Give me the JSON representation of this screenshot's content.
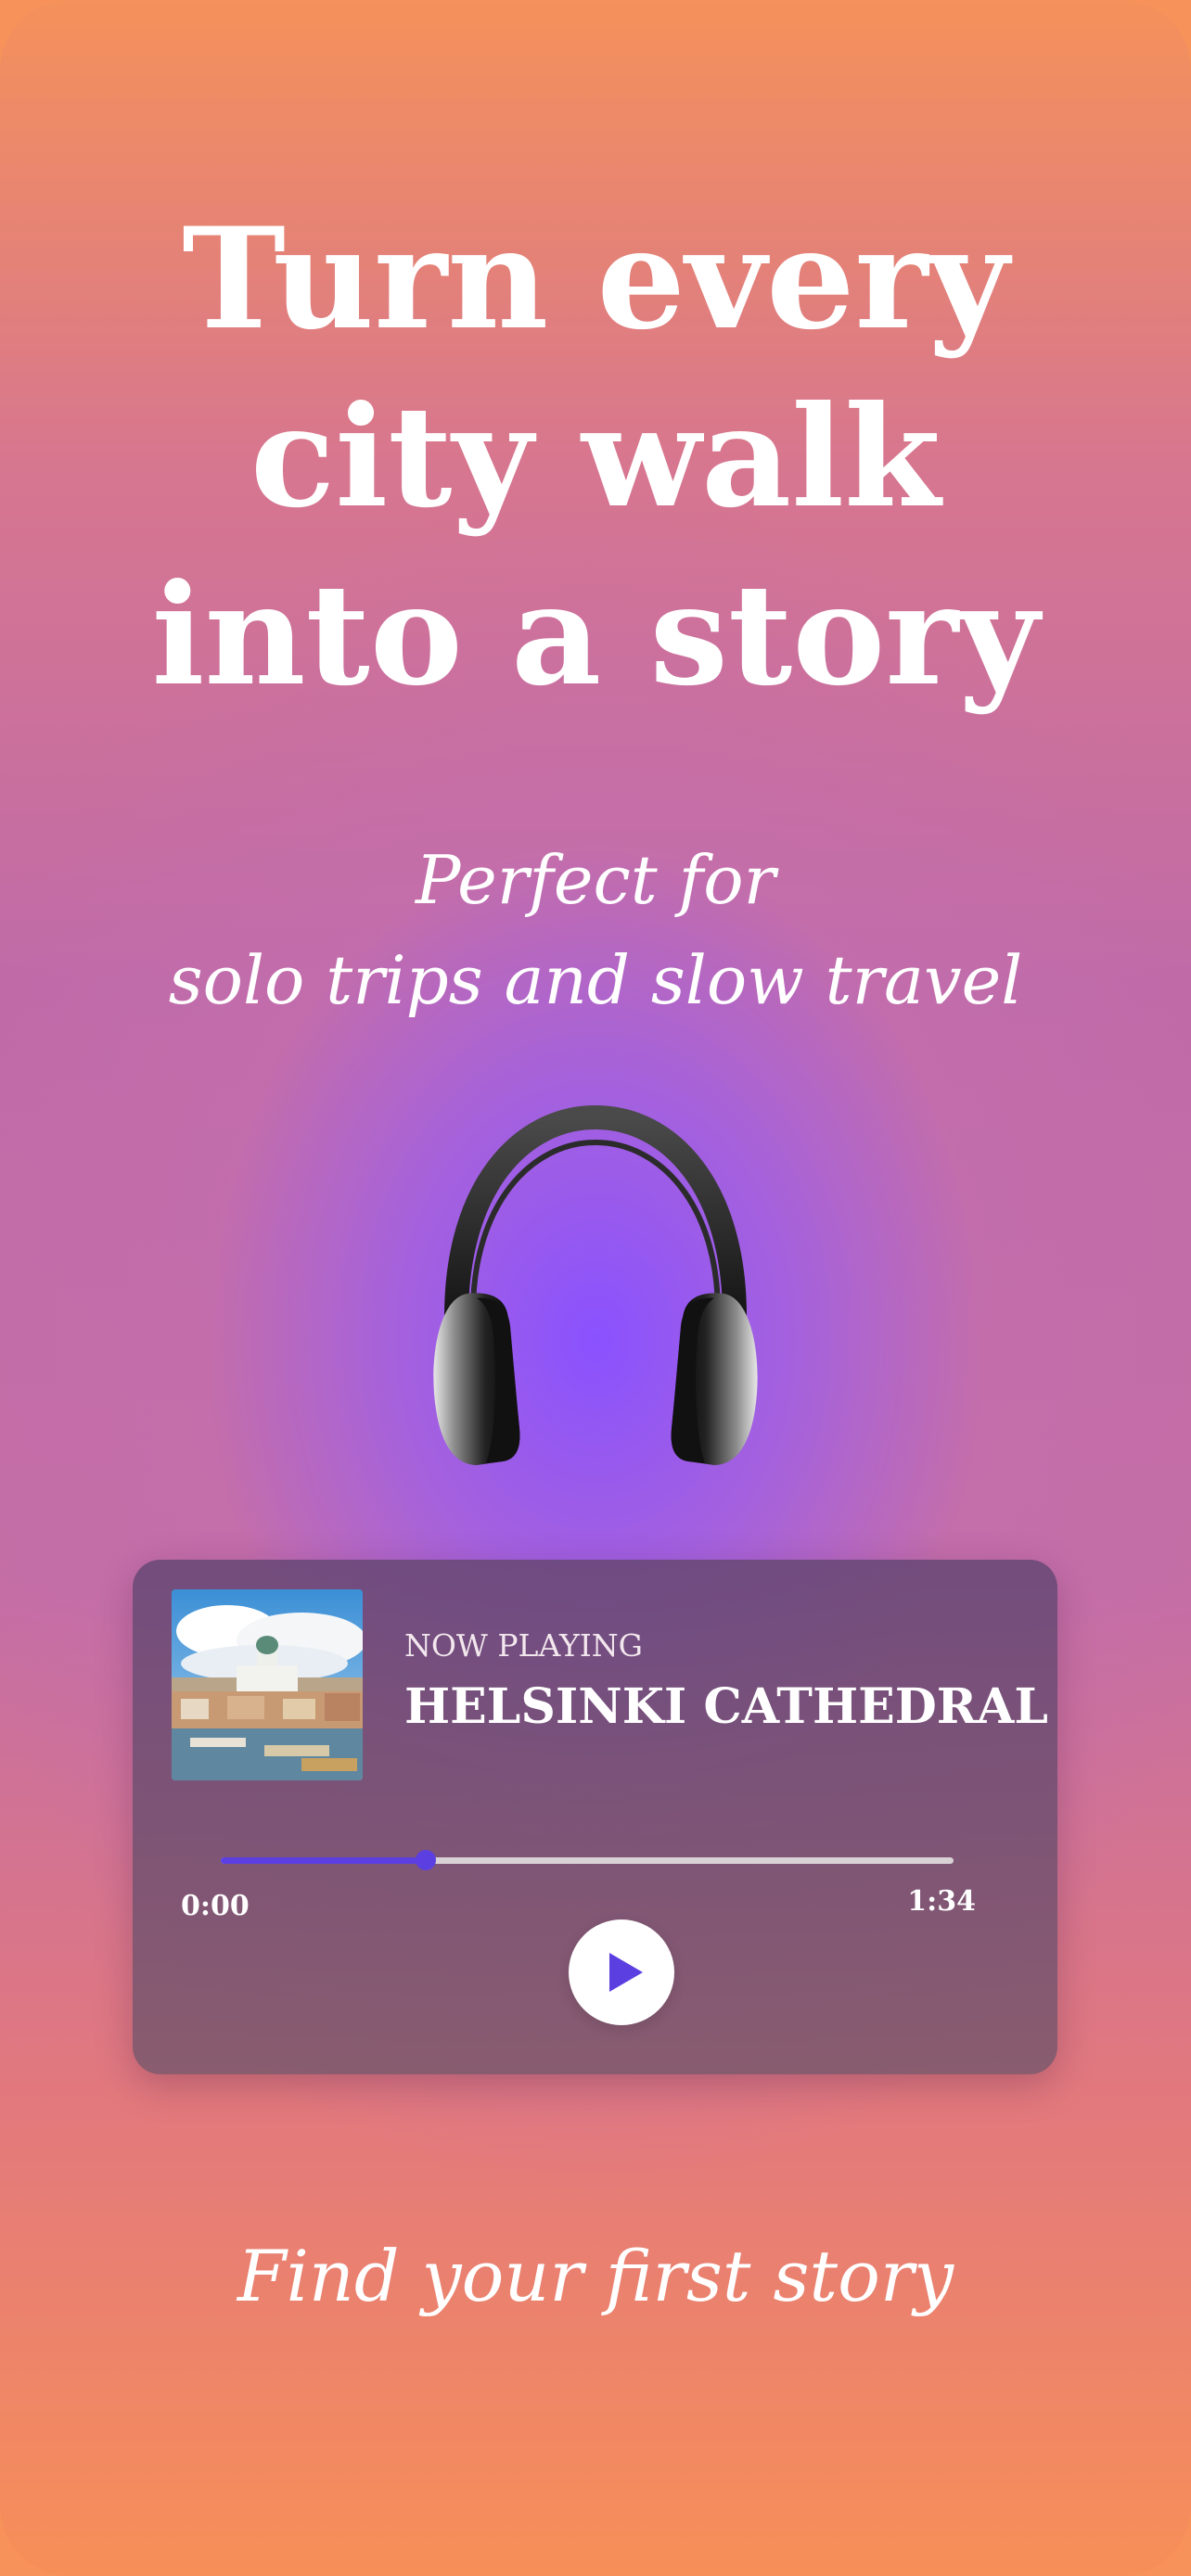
{
  "headline": "Turn every\ncity walk\ninto a story",
  "subhead": {
    "line1": "Perfect for",
    "line2": "solo trips and slow travel"
  },
  "player": {
    "label": "NOW PLAYING",
    "title": "HELSINKI CATHEDRAL",
    "time_start": "0:00",
    "time_end": "1:34",
    "progress": 0.28,
    "accent_color": "#5b3fe0"
  },
  "cta": "Find your first story",
  "icons": [
    "headphones-icon",
    "play-icon"
  ]
}
